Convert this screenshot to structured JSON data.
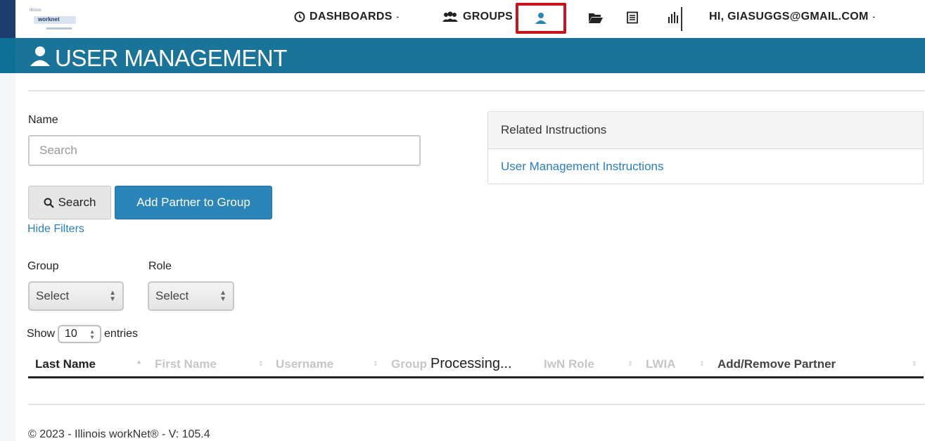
{
  "nav": {
    "logo_text": "worknet",
    "dashboards_label": "DASHBOARDS",
    "groups_label": "GROUPS",
    "user_greeting": "HI, GIASUGGS@GMAIL.COM"
  },
  "banner": {
    "title": "USER MANAGEMENT"
  },
  "form": {
    "name_label": "Name",
    "search_placeholder": "Search",
    "search_button": "Search",
    "add_partner_button": "Add Partner to Group",
    "hide_filters_link": "Hide Filters",
    "group_label": "Group",
    "role_label": "Role",
    "group_select_value": "Select",
    "role_select_value": "Select",
    "show_label": "Show",
    "entries_value": "10",
    "entries_label": "entries"
  },
  "related": {
    "header": "Related Instructions",
    "link": "User Management Instructions"
  },
  "table": {
    "columns": [
      "Last Name",
      "First Name",
      "Username",
      "Group",
      "IwN Role",
      "LWIA",
      "Add/Remove Partner"
    ],
    "processing_text": "Processing..."
  },
  "footer": {
    "text": "© 2023 - Illinois workNet® - V: 105.4"
  },
  "colors": {
    "banner": "#1a7398",
    "primary_button": "#2b85b8",
    "link": "#2a7fbd",
    "highlight_box": "#c4161c"
  }
}
